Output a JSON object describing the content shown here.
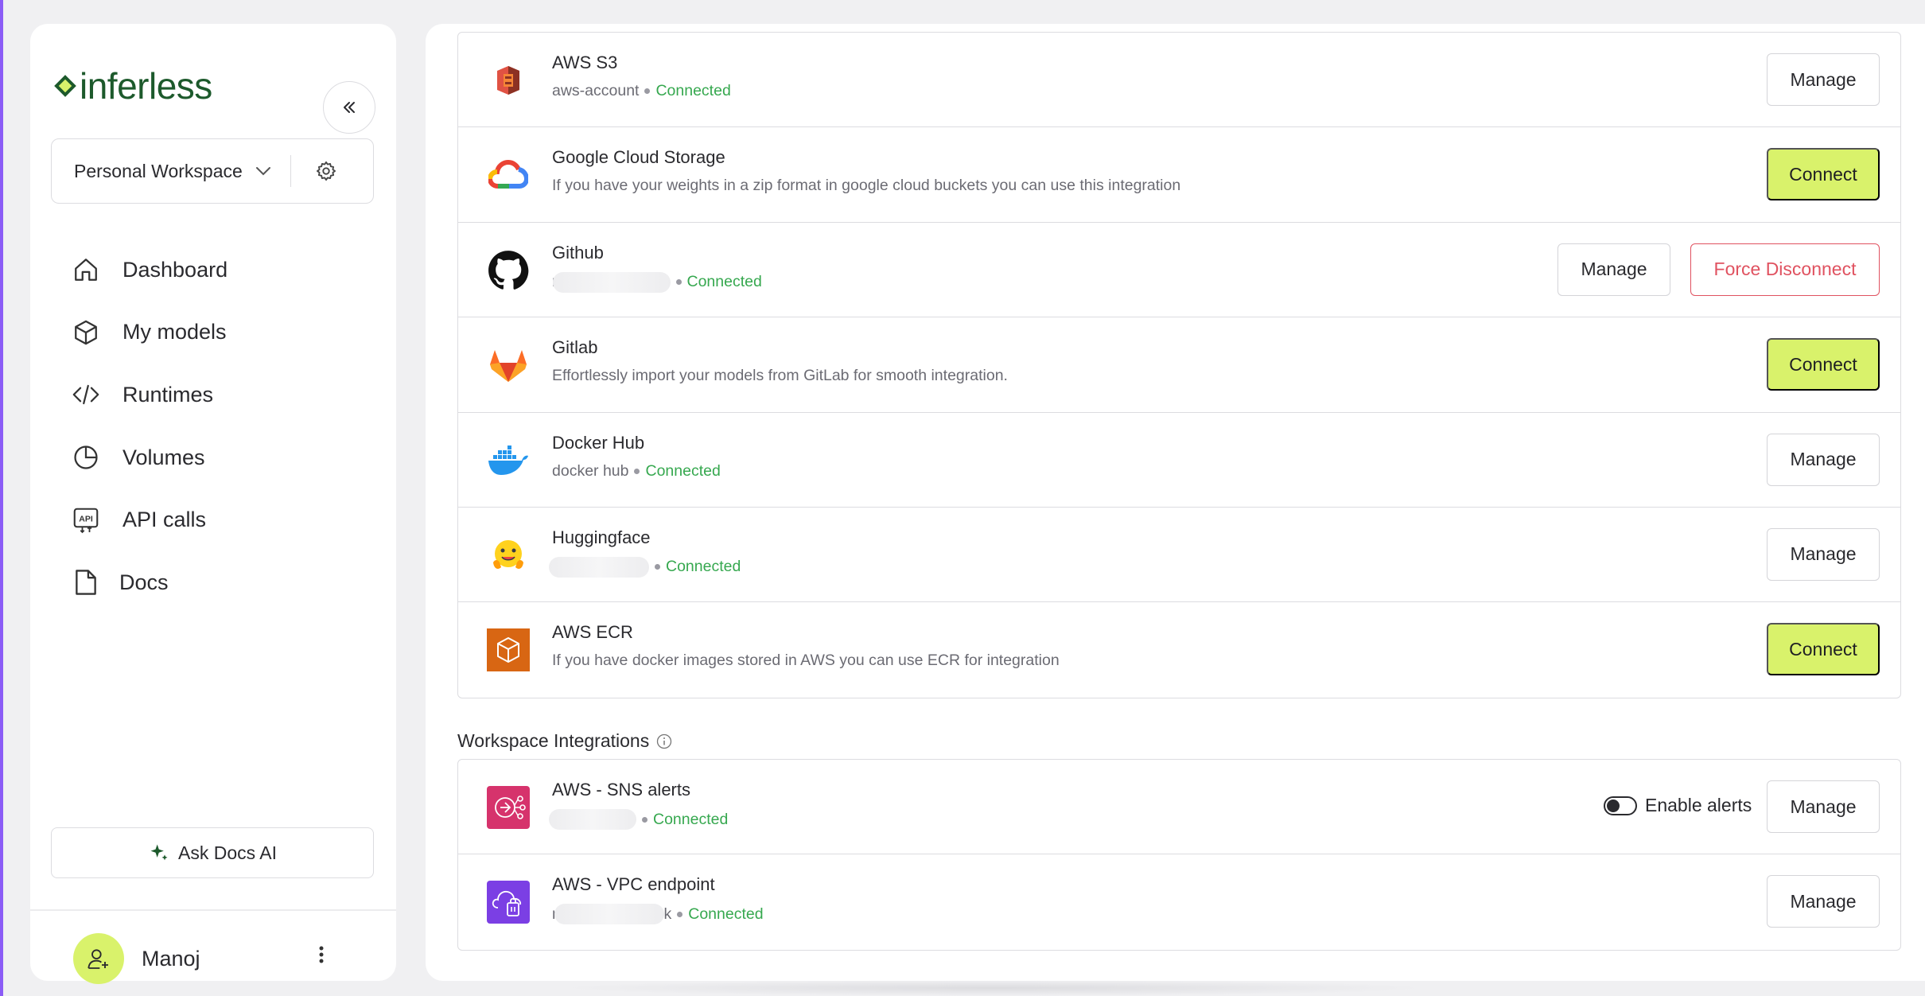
{
  "brand": {
    "name": "inferless"
  },
  "sidebar": {
    "workspace": "Personal Workspace",
    "nav": [
      {
        "label": "Dashboard",
        "icon": "home-icon"
      },
      {
        "label": "My models",
        "icon": "cube-icon"
      },
      {
        "label": "Runtimes",
        "icon": "code-icon"
      },
      {
        "label": "Volumes",
        "icon": "pie-chart-icon"
      },
      {
        "label": "API calls",
        "icon": "api-icon"
      },
      {
        "label": "Docs",
        "icon": "document-icon"
      }
    ],
    "ask_docs": "Ask Docs AI",
    "user": {
      "name": "Manoj"
    }
  },
  "integrations": [
    {
      "name": "AWS S3",
      "account": "aws-account",
      "status": "Connected",
      "icon": "aws-s3-icon",
      "actions": [
        "Manage"
      ]
    },
    {
      "name": "Google Cloud Storage",
      "description": "If you have your weights in a zip format in google cloud buckets you can use this integration",
      "icon": "google-cloud-icon",
      "actions": [
        "Connect"
      ]
    },
    {
      "name": "Github",
      "account": "r",
      "status": "Connected",
      "icon": "github-icon",
      "actions": [
        "Manage",
        "Force Disconnect"
      ]
    },
    {
      "name": "Gitlab",
      "description": "Effortlessly import your models from GitLab for smooth integration.",
      "icon": "gitlab-icon",
      "actions": [
        "Connect"
      ]
    },
    {
      "name": "Docker Hub",
      "account": "docker hub",
      "status": "Connected",
      "icon": "docker-icon",
      "actions": [
        "Manage"
      ]
    },
    {
      "name": "Huggingface",
      "status": "Connected",
      "icon": "huggingface-icon",
      "actions": [
        "Manage"
      ]
    },
    {
      "name": "AWS ECR",
      "description": "If you have docker images stored in AWS you can use ECR for integration",
      "icon": "aws-ecr-icon",
      "actions": [
        "Connect"
      ]
    }
  ],
  "workspace_integrations": {
    "title": "Workspace Integrations",
    "items": [
      {
        "name": "AWS - SNS alerts",
        "status": "Connected",
        "icon": "aws-sns-icon",
        "toggle_label": "Enable alerts",
        "toggle_on": false,
        "actions": [
          "Manage"
        ]
      },
      {
        "name": "AWS - VPC endpoint",
        "account": "r",
        "account_suffix": "k",
        "status": "Connected",
        "icon": "aws-vpc-icon",
        "actions": [
          "Manage"
        ]
      }
    ]
  },
  "colors": {
    "accent": "#d9f26b",
    "connected": "#36a84f",
    "danger": "#e05260",
    "brand": "#1d5a2c"
  }
}
